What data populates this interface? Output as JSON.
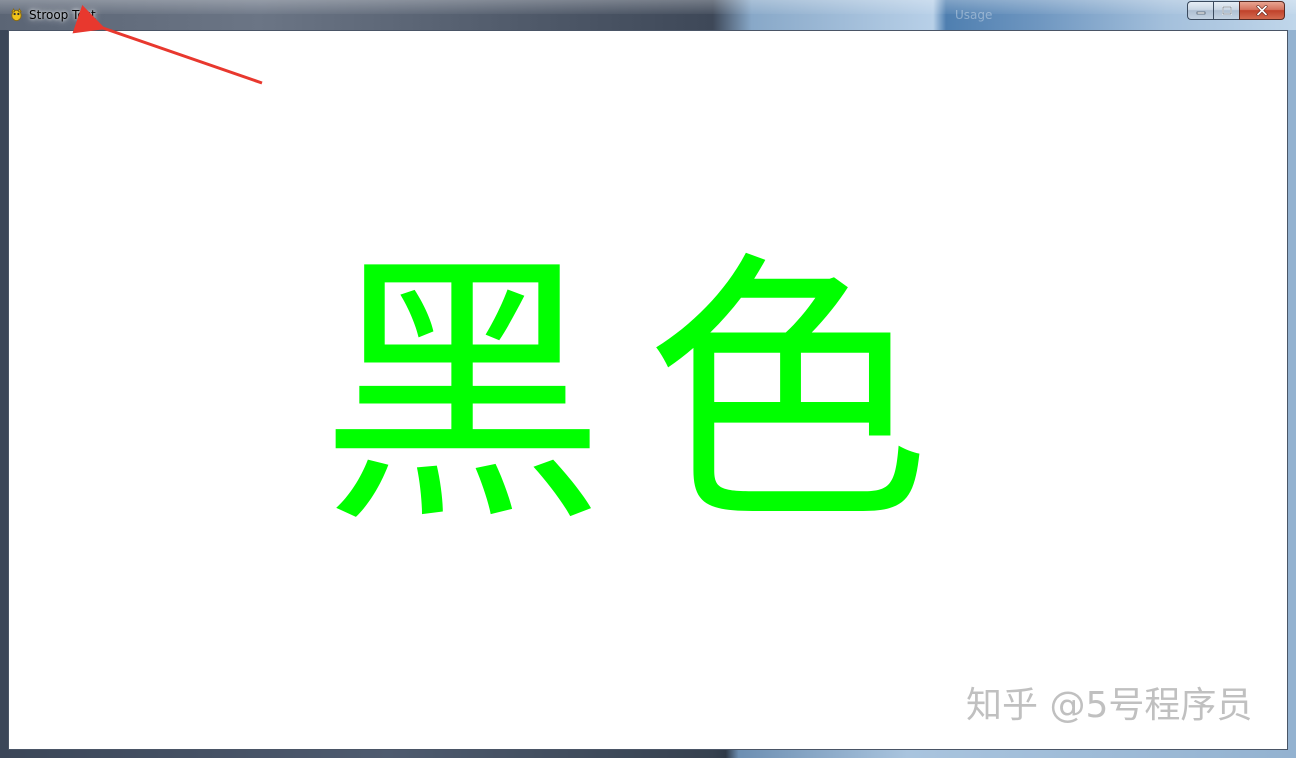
{
  "window": {
    "title": "Stroop Test",
    "background_tab_text": "Usage"
  },
  "stimulus": {
    "word": "黑色",
    "ink_color": "#00ff00"
  },
  "watermark": {
    "text": "知乎 @5号程序员"
  },
  "colors": {
    "annotation_arrow": "#e8382e",
    "canvas_background": "#ffffff"
  },
  "icons": {
    "app": "pygame-snake-icon",
    "minimize": "minimize-icon",
    "maximize": "maximize-icon",
    "close": "close-icon"
  }
}
